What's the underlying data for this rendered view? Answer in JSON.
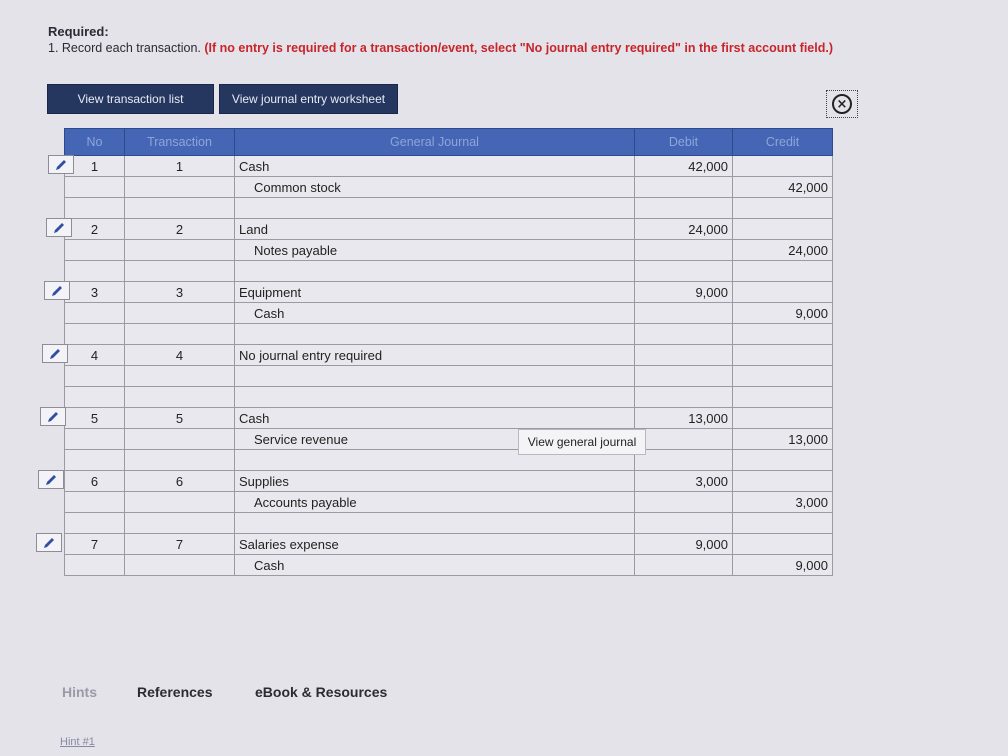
{
  "required": {
    "label": "Required:",
    "instruction": "1. Record each transaction.",
    "note": "(If no entry is required for a transaction/event, select \"No journal entry required\" in the first account field.)"
  },
  "buttons": {
    "view_transaction_list": "View transaction list",
    "view_journal_worksheet": "View journal entry worksheet"
  },
  "close_icon_glyph": "×",
  "table": {
    "headers": {
      "no": "No",
      "transaction": "Transaction",
      "general_journal": "General Journal",
      "debit": "Debit",
      "credit": "Credit"
    },
    "entries": [
      {
        "no": "1",
        "transaction": "1",
        "debit_account": "Cash",
        "credit_account": "Common stock",
        "debit": "42,000",
        "credit": "42,000"
      },
      {
        "no": "2",
        "transaction": "2",
        "debit_account": "Land",
        "credit_account": "Notes payable",
        "debit": "24,000",
        "credit": "24,000"
      },
      {
        "no": "3",
        "transaction": "3",
        "debit_account": "Equipment",
        "credit_account": "Cash",
        "debit": "9,000",
        "credit": "9,000"
      },
      {
        "no": "4",
        "transaction": "4",
        "debit_account": "No journal entry required",
        "credit_account": "",
        "debit": "",
        "credit": ""
      },
      {
        "no": "5",
        "transaction": "5",
        "debit_account": "Cash",
        "credit_account": "Service revenue",
        "debit": "13,000",
        "credit": "13,000"
      },
      {
        "no": "6",
        "transaction": "6",
        "debit_account": "Supplies",
        "credit_account": "Accounts payable",
        "debit": "3,000",
        "credit": "3,000"
      },
      {
        "no": "7",
        "transaction": "7",
        "debit_account": "Salaries expense",
        "credit_account": "Cash",
        "debit": "9,000",
        "credit": "9,000"
      }
    ]
  },
  "tooltip": "View general journal",
  "footer": {
    "hints": "Hints",
    "references": "References",
    "ebook": "eBook & Resources",
    "hint1": "Hint #1"
  },
  "colors": {
    "header_blue": "#4466b5",
    "button_navy": "#25365f",
    "note_red": "#c8252a",
    "pencil_blue": "#2f4fa0"
  }
}
